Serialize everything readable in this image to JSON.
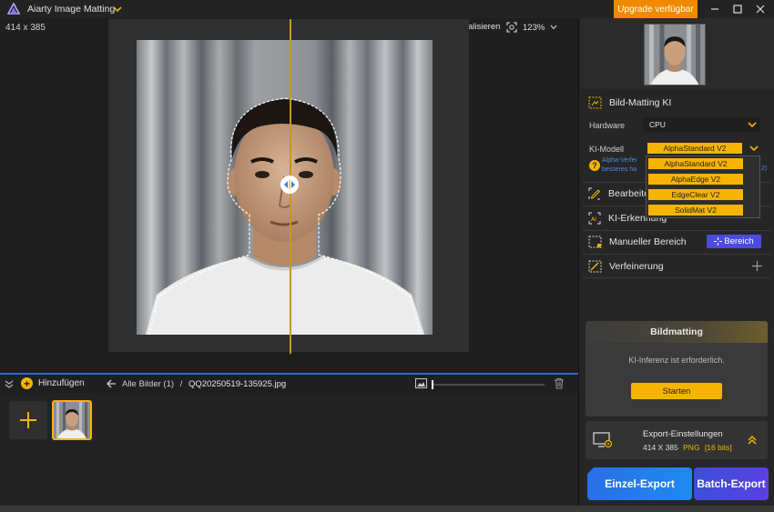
{
  "titlebar": {
    "app_title": "Aiarty Image Matting",
    "upgrade_label": "Upgrade verfügbar"
  },
  "canvas": {
    "dimensions": "414 x 385",
    "refresh_label": "Aktualisieren",
    "zoom_level": "123%"
  },
  "strip": {
    "add_label": "Hinzufügen",
    "breadcrumb_root": "Alle Bilder (1)",
    "breadcrumb_sep": "/",
    "file_name": "QQ20250519-135925.jpg"
  },
  "panel": {
    "matting_title": "Bild-Matting KI",
    "hardware_label": "Hardware",
    "hardware_value": "CPU",
    "model_label": "KI-Modell",
    "model_value": "AlphaStandard  V2",
    "model_options": [
      "AlphaStandard  V2",
      "AlphaEdge  V2",
      "EdgeClear  V2",
      "SolidMat  V2"
    ],
    "help_line1": "Alpha-Verfei",
    "help_line2": "besseres ha",
    "help_tail": "2)",
    "sections": {
      "bearbeiten": "Bearbeiten",
      "ki_erkennung": "KI-Erkennung",
      "manueller": "Manueller Bereich",
      "bereich_btn": "Bereich",
      "verfeinerung": "Verfeinerung"
    },
    "bildmatting": {
      "title": "Bildmatting",
      "message": "KI-Inferenz ist erforderlich.",
      "start_label": "Starten"
    },
    "export": {
      "title": "Export-Einstellungen",
      "dims": "414 X 385",
      "format": "PNG",
      "bits": "[16 bits]",
      "single_label": "Einzel-Export",
      "batch_label": "Batch-Export"
    }
  },
  "colors": {
    "accent": "#f5b400",
    "upgrade": "#f08a00",
    "bereich": "#4c4be0",
    "link": "#4b8fe3"
  }
}
